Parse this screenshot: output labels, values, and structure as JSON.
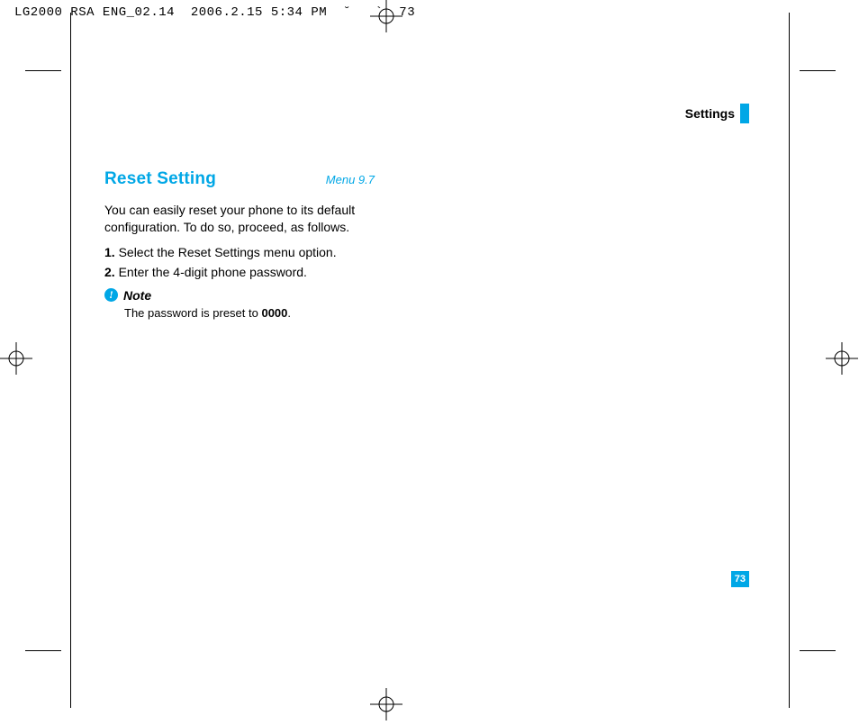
{
  "meta": {
    "doc_id": "LG2000 RSA ENG_02.14",
    "timestamp": "2006.2.15 5:34 PM",
    "page_marker": "73"
  },
  "section_header": "Settings",
  "title": "Reset Setting",
  "menu_ref": "Menu 9.7",
  "body": "You can easily reset your phone to its default configuration. To do so, proceed, as follows.",
  "steps": [
    {
      "num": "1.",
      "text": " Select the Reset Settings menu option."
    },
    {
      "num": "2.",
      "text": " Enter the 4-digit phone password."
    }
  ],
  "note": {
    "label": "Note",
    "text_prefix": "The password is preset to ",
    "value": "0000",
    "text_suffix": "."
  },
  "page_number": "73"
}
